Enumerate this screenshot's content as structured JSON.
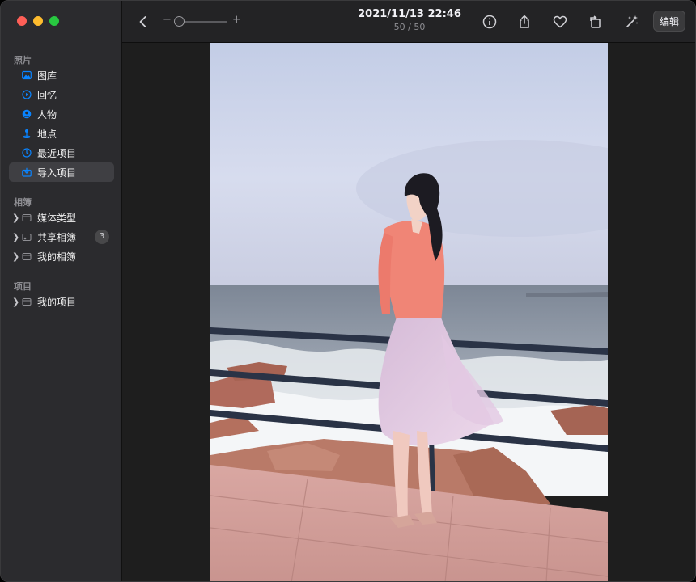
{
  "window": {
    "traffic_lights": [
      "close",
      "minimize",
      "zoom"
    ]
  },
  "sidebar": {
    "photos_section": "照片",
    "photos_items": [
      {
        "label": "图库",
        "icon": "photo-library-icon"
      },
      {
        "label": "回忆",
        "icon": "memories-icon"
      },
      {
        "label": "人物",
        "icon": "people-icon"
      },
      {
        "label": "地点",
        "icon": "places-icon"
      },
      {
        "label": "最近项目",
        "icon": "recents-icon"
      },
      {
        "label": "导入项目",
        "icon": "imports-icon",
        "selected": true
      }
    ],
    "albums_section": "相簿",
    "album_items": [
      {
        "label": "媒体类型",
        "icon": "folder-icon"
      },
      {
        "label": "共享相簿",
        "icon": "shared-album-icon",
        "badge": "3"
      },
      {
        "label": "我的相簿",
        "icon": "folder-icon"
      }
    ],
    "projects_section": "项目",
    "project_items": [
      {
        "label": "我的项目",
        "icon": "folder-icon"
      }
    ]
  },
  "toolbar": {
    "zoom_minus": "−",
    "zoom_plus": "+",
    "zoom_level": 0.0,
    "title_date": "2021/11/13 22:46",
    "title_count": "50 / 50",
    "edit_label": "编辑",
    "icons": [
      "back-icon",
      "info-icon",
      "share-icon",
      "favorite-icon",
      "rotate-icon",
      "auto-enhance-icon"
    ]
  },
  "colors": {
    "accent": "#0a84ff",
    "sidebar_bg": "#2b2b2e",
    "toolbar_bg": "#232325",
    "content_bg": "#1e1e1e"
  }
}
